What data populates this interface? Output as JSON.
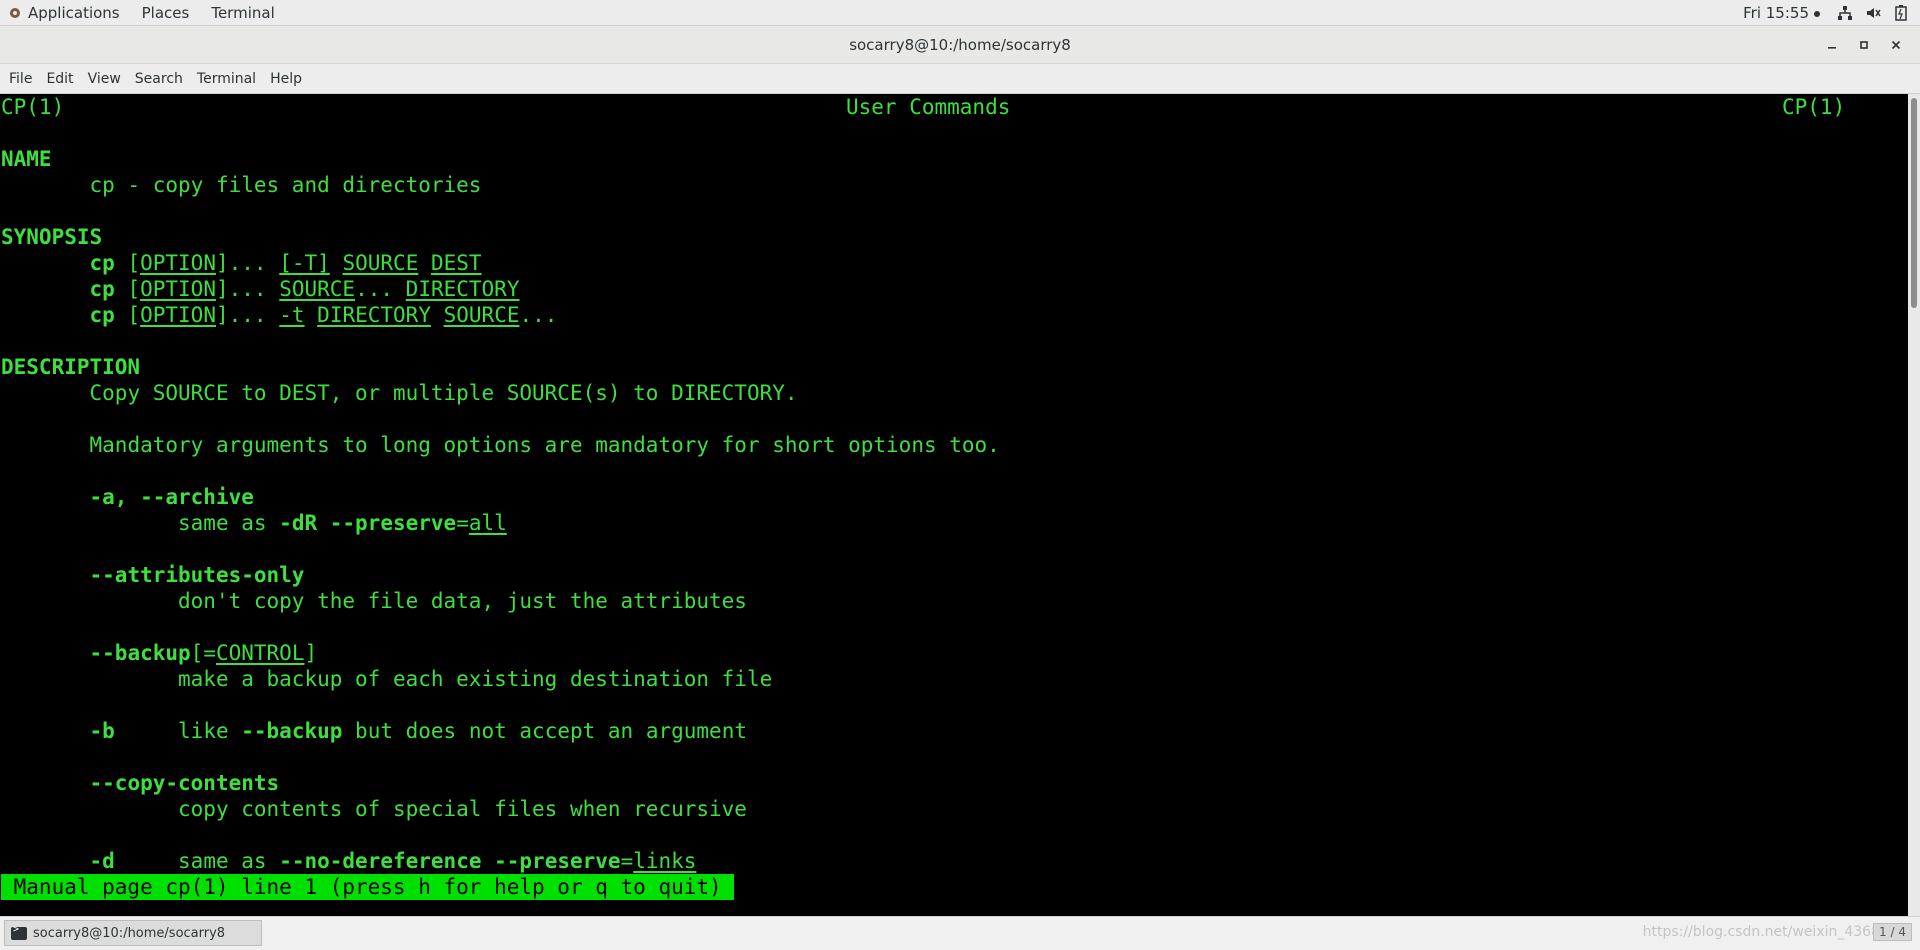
{
  "top_panel": {
    "applications": "Applications",
    "places": "Places",
    "terminal": "Terminal",
    "clock": "Fri 15:55"
  },
  "window": {
    "title": "socarry8@10:/home/socarry8"
  },
  "menubar": [
    "File",
    "Edit",
    "View",
    "Search",
    "Terminal",
    "Help"
  ],
  "man": {
    "header_left": "CP(1)",
    "header_center": "User Commands",
    "header_right": "CP(1)",
    "name_heading": "NAME",
    "name_text": "cp - copy files and directories",
    "synopsis_heading": "SYNOPSIS",
    "syn_cmd": "cp",
    "syn_option": "OPTION",
    "syn_dots": "...",
    "syn_T": "-T",
    "syn_source": "SOURCE",
    "syn_dest": "DEST",
    "syn_directory": "DIRECTORY",
    "syn_t": "-t",
    "description_heading": "DESCRIPTION",
    "desc_line1": "Copy SOURCE to DEST, or multiple SOURCE(s) to DIRECTORY.",
    "desc_line2": "Mandatory arguments to long options are mandatory for short options too.",
    "opt_a": "-a, --archive",
    "opt_a_desc_pre": "same as ",
    "opt_a_desc_flag": "-dR --preserve",
    "opt_a_desc_eq": "=",
    "opt_a_desc_val": "all",
    "opt_attr": "--attributes-only",
    "opt_attr_desc": "don't copy the file data, just the attributes",
    "opt_backup": "--backup",
    "opt_backup_bracket_open": "[=",
    "opt_backup_arg": "CONTROL",
    "opt_backup_bracket_close": "]",
    "opt_backup_desc": "make a backup of each existing destination file",
    "opt_b": "-b",
    "opt_b_desc_pre": "like ",
    "opt_b_desc_flag": "--backup",
    "opt_b_desc_post": " but does not accept an argument",
    "opt_copy": "--copy-contents",
    "opt_copy_desc": "copy contents of special files when recursive",
    "opt_d": "-d",
    "opt_d_desc_pre": "same as ",
    "opt_d_desc_flag": "--no-dereference --preserve",
    "opt_d_desc_eq": "=",
    "opt_d_desc_val": "links",
    "status": " Manual page cp(1) line 1 (press h for help or q to quit)"
  },
  "taskbar": {
    "task_label": "socarry8@10:/home/socarry8",
    "watermark": "https://blog.csdn.net/weixin_4368",
    "workspace": "1 / 4"
  }
}
